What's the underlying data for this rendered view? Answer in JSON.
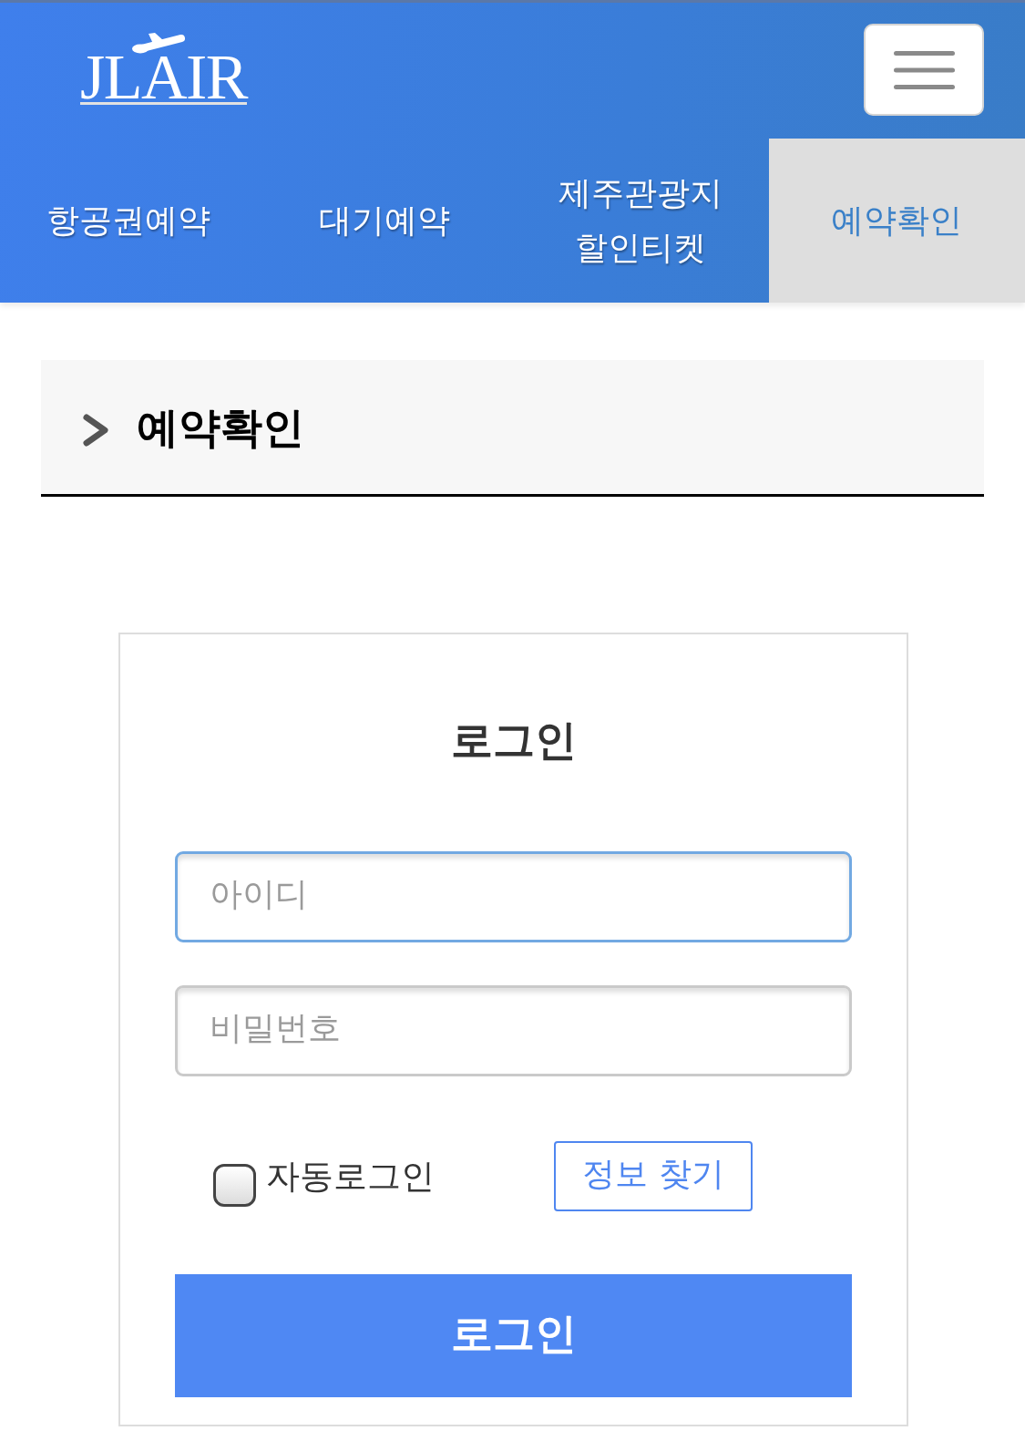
{
  "header": {
    "logo": "JLAIR"
  },
  "nav": {
    "tabs": [
      {
        "label": "항공권예약",
        "selected": false
      },
      {
        "label": "대기예약",
        "selected": false
      },
      {
        "label": "제주관광지 할인티켓",
        "selected": false
      },
      {
        "label": "예약확인",
        "selected": true
      }
    ]
  },
  "page_title": "예약확인",
  "login": {
    "title": "로그인",
    "fields": [
      {
        "placeholder": "아이디",
        "focused": true
      },
      {
        "placeholder": "비밀번호",
        "focused": false
      }
    ],
    "auto_login": {
      "label": "자동로그인",
      "checked": false
    },
    "find_button": "정보 찾기",
    "submit_button": "로그인"
  }
}
